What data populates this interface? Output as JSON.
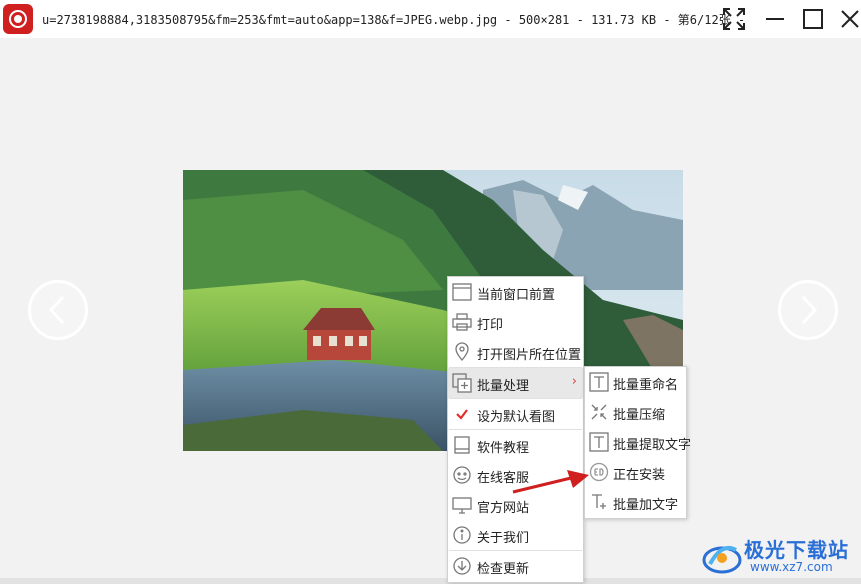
{
  "window": {
    "title": "u=2738198884,3183508795&fm=253&fmt=auto&app=138&f=JPEG.webp.jpg - 500×281 - 131.73 KB - 第6/12张 -",
    "fullscreen_icon": "fullscreen-icon",
    "maximize_icon": "maximize-icon",
    "close_icon": "close-icon"
  },
  "context_menu": {
    "items": [
      {
        "label": "当前窗口前置",
        "icon": "window-front-icon"
      },
      {
        "label": "打印",
        "icon": "printer-icon"
      },
      {
        "label": "打开图片所在位置",
        "icon": "location-pin-icon"
      },
      {
        "label": "批量处理",
        "icon": "batch-icon",
        "has_submenu": true
      },
      {
        "label": "设为默认看图",
        "icon": "checkmark-icon",
        "checked": true
      },
      {
        "label": "软件教程",
        "icon": "book-icon"
      },
      {
        "label": "在线客服",
        "icon": "headset-icon"
      },
      {
        "label": "官方网站",
        "icon": "monitor-icon"
      },
      {
        "label": "关于我们",
        "icon": "info-icon"
      },
      {
        "label": "检查更新",
        "icon": "download-icon"
      }
    ],
    "submenu_arrow": "›"
  },
  "submenu": {
    "items": [
      {
        "label": "批量重命名",
        "icon": "text-t-icon"
      },
      {
        "label": "批量压缩",
        "icon": "compress-icon"
      },
      {
        "label": "批量提取文字",
        "icon": "text-t-icon"
      },
      {
        "label": "正在安装",
        "icon": "installing-icon"
      },
      {
        "label": "批量加文字",
        "icon": "add-text-icon"
      }
    ]
  },
  "watermark": {
    "name": "极光下载站",
    "url": "www.xz7.com"
  },
  "colors": {
    "accent_red": "#d01f1f",
    "check_red": "#e0302c",
    "watermark_blue": "#2a6fd6"
  }
}
